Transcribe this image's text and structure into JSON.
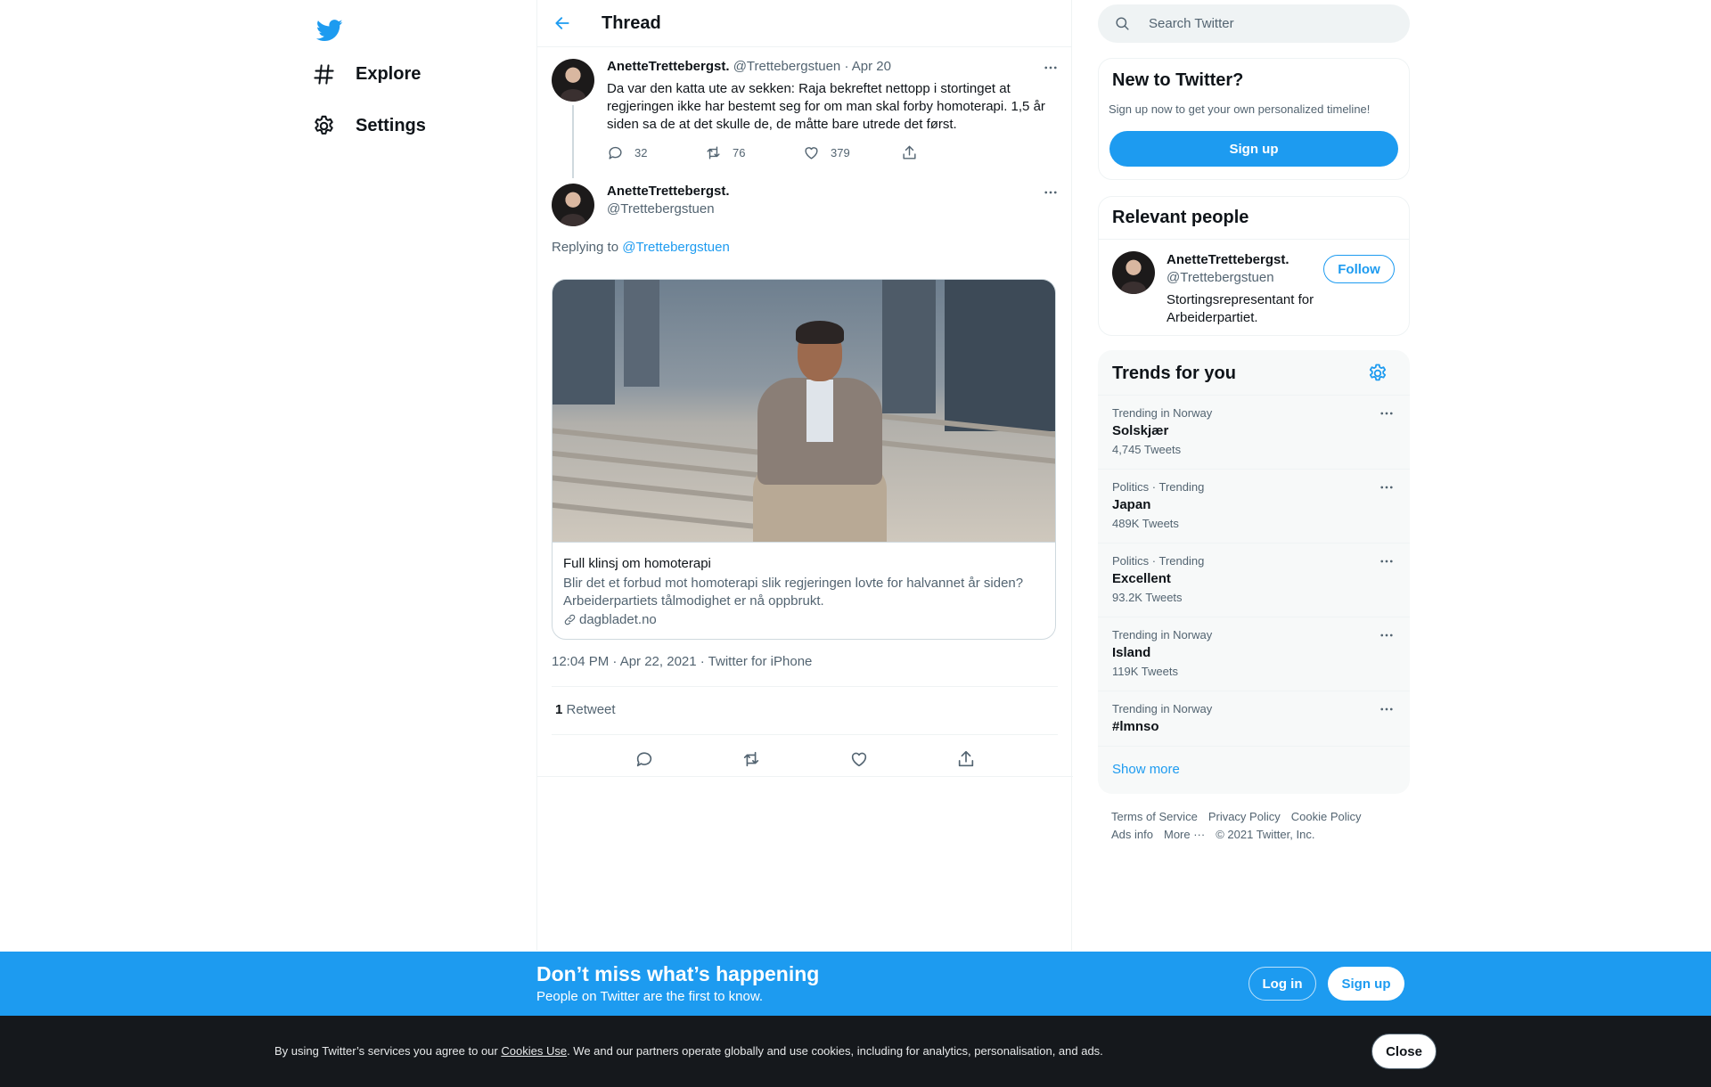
{
  "colors": {
    "accent": "#1d9bf0",
    "text": "#0f1419",
    "muted": "#536471",
    "cookie_bg": "#15181c"
  },
  "sidebar": {
    "logo_icon": "twitter-bird-icon",
    "items": [
      {
        "label": "Explore",
        "icon": "hashtag-icon"
      },
      {
        "label": "Settings",
        "icon": "gear-icon"
      }
    ]
  },
  "header": {
    "title": "Thread",
    "back_icon": "arrow-left-icon"
  },
  "tweet1": {
    "name": "AnetteTrettebergst.",
    "handle": "@Trettebergstuen",
    "dot": "·",
    "date": "Apr 20",
    "text": "Da var den katta ute av sekken: Raja bekreftet nettopp i stortinget at regjeringen ikke har bestemt seg for om man skal forby homoterapi. 1,5 år siden sa de at det skulle de, de måtte bare utrede det først.",
    "replies": "32",
    "retweets": "76",
    "likes": "379"
  },
  "tweet2": {
    "name": "AnetteTrettebergst.",
    "handle": "@Trettebergstuen",
    "replying_prefix": "Replying to",
    "replying_to": "@Trettebergstuen",
    "card": {
      "title": "Full klinsj om homoterapi",
      "description": "Blir det et forbud mot homoterapi slik regjeringen lovte for halvannet år siden? Arbeiderpartiets tålmodighet er nå oppbrukt.",
      "domain": "dagbladet.no"
    },
    "timestamp": "12:04 PM · Apr 22, 2021 · Twitter for iPhone",
    "retweet_count": "1",
    "retweet_label": "Retweet"
  },
  "search": {
    "placeholder": "Search Twitter"
  },
  "new_to_twitter": {
    "title": "New to Twitter?",
    "subtitle": "Sign up now to get your own personalized timeline!",
    "button": "Sign up"
  },
  "relevant_people": {
    "title": "Relevant people",
    "name": "AnetteTrettebergst.",
    "handle": "@Trettebergstuen",
    "bio": "Stortingsrepresentant for Arbeiderpartiet.",
    "follow": "Follow"
  },
  "trends": {
    "title": "Trends for you",
    "items": [
      {
        "context": "Trending in Norway",
        "name": "Solskjær",
        "count": "4,745 Tweets"
      },
      {
        "context": "Politics · Trending",
        "name": "Japan",
        "count": "489K Tweets"
      },
      {
        "context": "Politics · Trending",
        "name": "Excellent",
        "count": "93.2K Tweets"
      },
      {
        "context": "Trending in Norway",
        "name": "Island",
        "count": "119K Tweets"
      },
      {
        "context": "Trending in Norway",
        "name": "#lmnso",
        "count": ""
      }
    ],
    "show_more": "Show more"
  },
  "footer": {
    "links": [
      "Terms of Service",
      "Privacy Policy",
      "Cookie Policy",
      "Ads info",
      "More ···",
      "© 2021 Twitter, Inc."
    ]
  },
  "banner": {
    "title": "Don’t miss what’s happening",
    "subtitle": "People on Twitter are the first to know.",
    "login": "Log in",
    "signup": "Sign up"
  },
  "cookie": {
    "prefix": "By using Twitter’s services you agree to our",
    "link": "Cookies Use",
    "suffix": ". We and our partners operate globally and use cookies, including for analytics, personalisation, and ads.",
    "close": "Close"
  }
}
